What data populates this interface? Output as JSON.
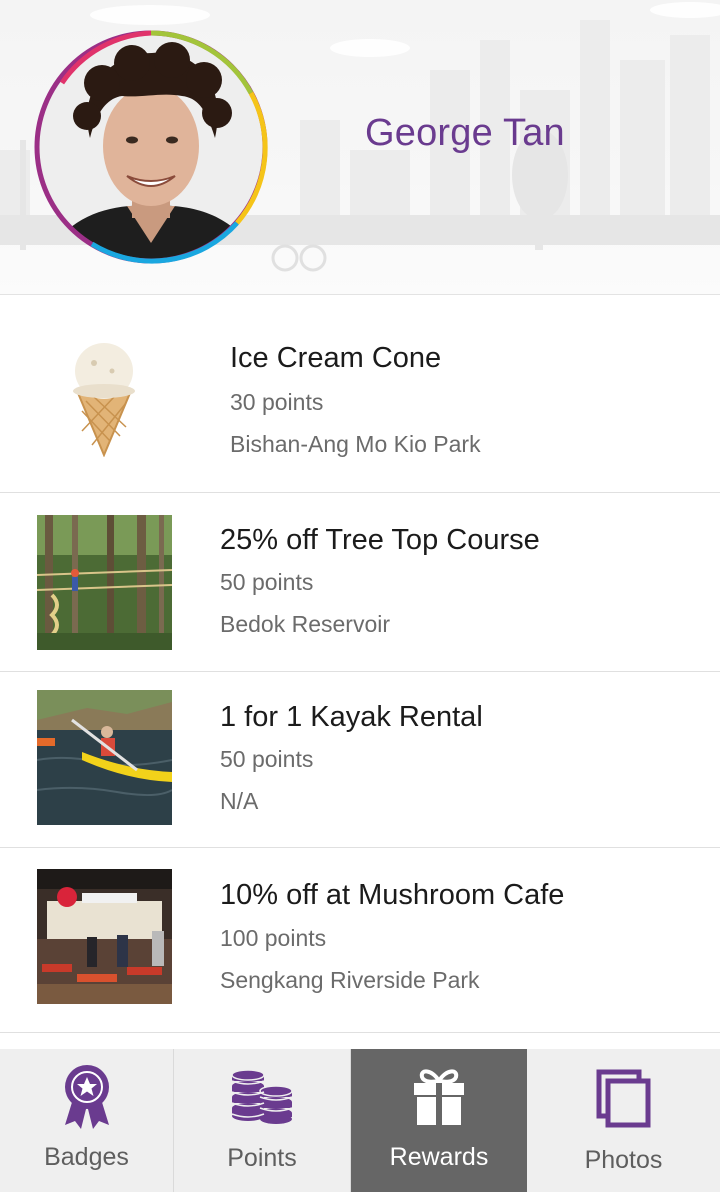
{
  "profile": {
    "name": "George Tan"
  },
  "rewards": [
    {
      "title": "Ice Cream Cone",
      "points": "30 points",
      "location": "Bishan-Ang Mo Kio Park",
      "image": "ice-cream-cone"
    },
    {
      "title": "25% off Tree Top Course",
      "points": "50 points",
      "location": "Bedok Reservoir",
      "image": "tree-top-course"
    },
    {
      "title": "1 for 1 Kayak Rental",
      "points": "50 points",
      "location": "N/A",
      "image": "kayak"
    },
    {
      "title": "10% off at Mushroom Cafe",
      "points": "100 points",
      "location": "Sengkang Riverside Park",
      "image": "mushroom-cafe"
    }
  ],
  "nav": {
    "items": [
      {
        "label": "Badges",
        "icon": "badge-icon"
      },
      {
        "label": "Points",
        "icon": "coins-icon"
      },
      {
        "label": "Rewards",
        "icon": "gift-icon",
        "active": true
      },
      {
        "label": "Photos",
        "icon": "photos-icon"
      }
    ]
  },
  "colors": {
    "accent": "#6a3b8f",
    "nav_active": "#666666",
    "nav_bg": "#efefef"
  }
}
